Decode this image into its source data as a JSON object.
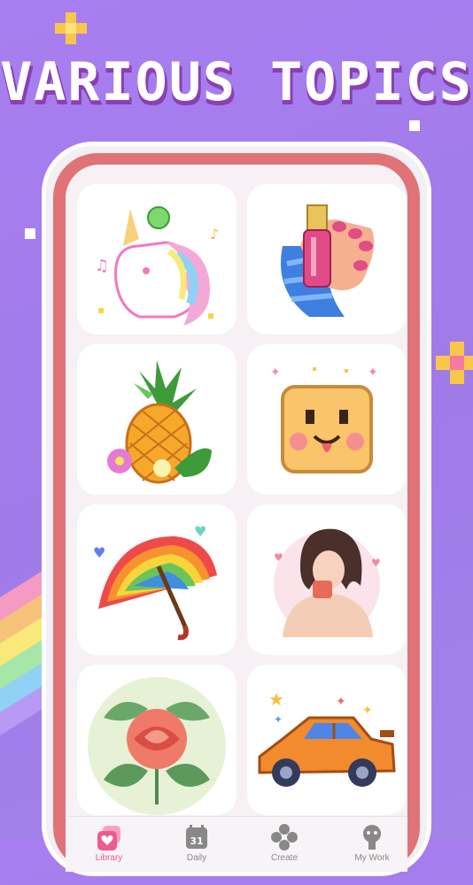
{
  "headline": "VARIOUS TOPICS",
  "colors": {
    "background": "#a97ef0",
    "headline_shadow": "#8a3fb4",
    "phone_frame": "#e07377",
    "accent_active": "#ef5a8f",
    "tab_inactive": "#888888"
  },
  "gallery": {
    "items": [
      {
        "name": "unicorn-artwork",
        "subject": "unicorn"
      },
      {
        "name": "nail-polish-artwork",
        "subject": "nail polish"
      },
      {
        "name": "pineapple-artwork",
        "subject": "pineapple"
      },
      {
        "name": "smiley-cookie-artwork",
        "subject": "smiley"
      },
      {
        "name": "rainbow-umbrella-artwork",
        "subject": "umbrella"
      },
      {
        "name": "girl-coffee-artwork",
        "subject": "girl"
      },
      {
        "name": "rose-artwork",
        "subject": "rose"
      },
      {
        "name": "sports-car-artwork",
        "subject": "car"
      }
    ]
  },
  "tabbar": {
    "library": {
      "label": "Library",
      "icon": "library-icon",
      "active": true
    },
    "daily": {
      "label": "Daily",
      "icon": "calendar-icon",
      "day": "31"
    },
    "create": {
      "label": "Create",
      "icon": "create-icon"
    },
    "mywork": {
      "label": "My Work",
      "icon": "profile-icon"
    }
  }
}
